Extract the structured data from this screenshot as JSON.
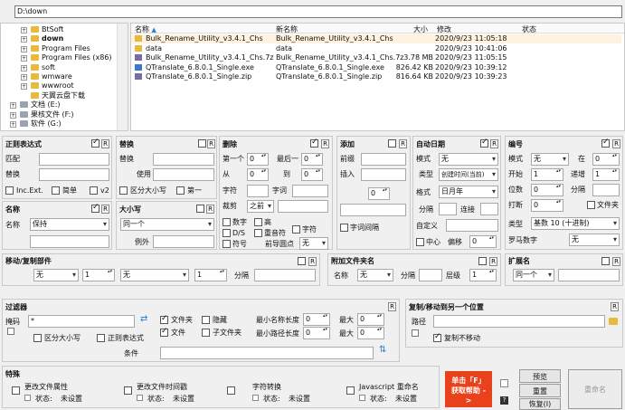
{
  "path": "D:\\down",
  "tree": [
    {
      "label": "BtSoft",
      "indent": 1,
      "exp": "+"
    },
    {
      "label": "down",
      "indent": 1,
      "exp": "+",
      "bold": true
    },
    {
      "label": "Program Files",
      "indent": 1,
      "exp": "+"
    },
    {
      "label": "Program Files (x86)",
      "indent": 1,
      "exp": "+"
    },
    {
      "label": "soft",
      "indent": 1,
      "exp": "+"
    },
    {
      "label": "wmware",
      "indent": 1,
      "exp": "+"
    },
    {
      "label": "wwwroot",
      "indent": 1,
      "exp": "+"
    },
    {
      "label": "天翼云盘下载",
      "indent": 1,
      "exp": ""
    },
    {
      "label": "文档 (E:)",
      "indent": 0,
      "exp": "+"
    },
    {
      "label": "果核文件 (F:)",
      "indent": 0,
      "exp": "+"
    },
    {
      "label": "软件 (G:)",
      "indent": 0,
      "exp": "+"
    }
  ],
  "columns": {
    "name": "名称",
    "newname": "新名称",
    "size": "大小",
    "modified": "修改",
    "status": "状态"
  },
  "files": [
    {
      "name": "Bulk_Rename_Utility_v3.4.1_Chs",
      "newname": "Bulk_Rename_Utility_v3.4.1_Chs",
      "size": "",
      "modified": "2020/9/23 11:05:18",
      "icon": "folder",
      "hl": true
    },
    {
      "name": "data",
      "newname": "data",
      "size": "",
      "modified": "2020/9/23 10:41:06",
      "icon": "folder",
      "hl": false
    },
    {
      "name": "Bulk_Rename_Utility_v3.4.1_Chs.7z",
      "newname": "Bulk_Rename_Utility_v3.4.1_Chs.7z",
      "size": "3.78 MB",
      "modified": "2020/9/23 11:05:15",
      "icon": "archive",
      "hl": false
    },
    {
      "name": "QTranslate_6.8.0.1_Single.exe",
      "newname": "QTranslate_6.8.0.1_Single.exe",
      "size": "826.42 KB",
      "modified": "2020/9/23 10:39:12",
      "icon": "exe",
      "hl": false
    },
    {
      "name": "QTranslate_6.8.0.1_Single.zip",
      "newname": "QTranslate_6.8.0.1_Single.zip",
      "size": "816.64 KB",
      "modified": "2020/9/23 10:39:23",
      "icon": "archive",
      "hl": false
    }
  ],
  "regex": {
    "title": "正则表达式",
    "match_label": "匹配",
    "replace_label": "替换",
    "inc_ext": "Inc.Ext.",
    "simple": "简单",
    "v2": "v2"
  },
  "replace": {
    "title": "替换",
    "replace_label": "替换",
    "with_label": "使用",
    "case": "区分大小写",
    "first": "第一"
  },
  "remove": {
    "title": "删除",
    "first_n": "第一个",
    "first_val": "0",
    "last_n": "最后一",
    "last_val": "0",
    "from": "从",
    "from_val": "0",
    "to": "到",
    "to_val": "0",
    "chars": "字符",
    "words": "字词",
    "crop": "裁剪",
    "crop_sel": "之前",
    "digits": "数字",
    "high": "高",
    "ds": "D/S",
    "accents": "重音符",
    "chars2": "字符",
    "symbols": "符号",
    "lead_dots": "前导圆点",
    "lead_sel": "无"
  },
  "add": {
    "title": "添加",
    "prefix": "前缀",
    "insert": "插入",
    "pos_val": "0",
    "word_space": "字词间隔"
  },
  "autodate": {
    "title": "自动日期",
    "mode": "模式",
    "mode_sel": "无",
    "type": "类型",
    "type_sel": "创建时间(当前)",
    "fmt": "格式",
    "fmt_sel": "日月年",
    "sep": "分隔",
    "connect": "连接",
    "custom": "自定义",
    "center": "中心",
    "offset": "偏移",
    "offset_val": "0"
  },
  "numbering": {
    "title": "编号",
    "mode": "模式",
    "mode_sel": "无",
    "at": "在",
    "at_val": "0",
    "start": "开始",
    "start_val": "1",
    "incr": "递增",
    "incr_val": "1",
    "pad": "位数",
    "pad_val": "0",
    "sep": "分隔",
    "break": "打断",
    "break_val": "0",
    "folder": "文件夹",
    "type": "类型",
    "type_sel": "基数 10 (十进制)",
    "roman": "罗马数字",
    "roman_sel": "无"
  },
  "name": {
    "title": "名称",
    "label": "名称",
    "sel": "保持"
  },
  "case": {
    "title": "大小写",
    "sel": "同一个",
    "except": "例外"
  },
  "movecopy": {
    "title": "移动/复制部件",
    "sel1": "无",
    "val1": "1",
    "sel2": "无",
    "val2": "1",
    "sep": "分隔"
  },
  "appendfolder": {
    "title": "附加文件夹名",
    "name": "名称",
    "name_sel": "无",
    "sep": "分隔",
    "levels": "层级",
    "levels_val": "1"
  },
  "extension": {
    "title": "扩展名",
    "sel": "同一个"
  },
  "filter": {
    "title": "过滤器",
    "mask": "掩码",
    "mask_val": "*",
    "folders": "文件夹",
    "hidden": "隐藏",
    "files": "文件",
    "subfolders": "子文件夹",
    "case": "区分大小写",
    "regex": "正则表达式",
    "name_len_min": "最小名称长度",
    "min_val": "0",
    "max1": "最大",
    "max1_val": "0",
    "path_len_min": "最小路径长度",
    "min2_val": "0",
    "max2": "最大",
    "max2_val": "0",
    "condition": "条件"
  },
  "copymove": {
    "title": "复制/移动到另一个位置",
    "path": "路径",
    "nomove": "复制不移动"
  },
  "special": {
    "title": "特殊",
    "attr": "更改文件属性",
    "time": "更改文件时间戳",
    "chartrans": "字符转换",
    "js": "Javascript 重命名",
    "status": "状态:",
    "unset": "未设置"
  },
  "help_btn": "单击「F」获取帮助 ->",
  "preview_btn": "预览",
  "reset_btn": "重置",
  "revert_btn": "恢复(I)",
  "rename_btn": "重命名",
  "r_label": "R",
  "colors": {
    "hl_row": "#fff2e0",
    "select": "#cde4f7",
    "help_red": "#e8411c",
    "folder": "#e8b93c"
  }
}
